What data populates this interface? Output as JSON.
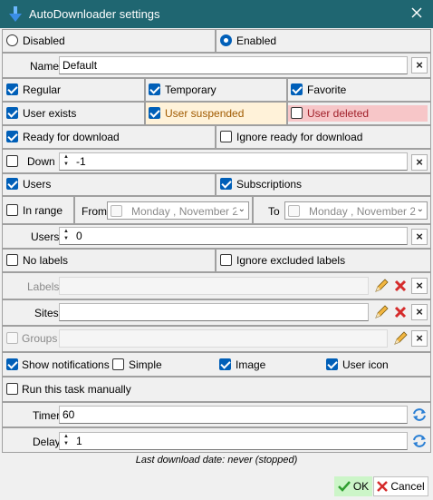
{
  "window": {
    "title": "AutoDownloader settings"
  },
  "mode": {
    "disabled": "Disabled",
    "enabled": "Enabled",
    "selected": "Enabled"
  },
  "name": {
    "label": "Name",
    "value": "Default"
  },
  "types": {
    "regular": "Regular",
    "temporary": "Temporary",
    "favorite": "Favorite",
    "user_exists": "User exists",
    "user_suspended": "User suspended",
    "user_deleted": "User deleted",
    "suspended_bg": "#fff2d9",
    "deleted_bg": "#f7c6c8"
  },
  "ready": {
    "ready_for_download": "Ready for download",
    "ignore_ready": "Ignore ready for download"
  },
  "down": {
    "label": "Down",
    "value": "-1"
  },
  "users_subs": {
    "users": "Users",
    "subscriptions": "Subscriptions"
  },
  "range": {
    "label": "In range",
    "from": "From",
    "to": "To",
    "from_date": "Monday    , November 2",
    "to_date": "Monday    , November 2"
  },
  "users_count": {
    "label": "Users",
    "value": "0"
  },
  "labels_opts": {
    "no_labels": "No labels",
    "ignore_excluded": "Ignore excluded labels"
  },
  "labels": {
    "label": "Labels",
    "value": ""
  },
  "sites": {
    "label": "Sites",
    "value": ""
  },
  "groups": {
    "label": "Groups",
    "value": ""
  },
  "notifications": {
    "show": "Show notifications",
    "simple": "Simple",
    "image": "Image",
    "user_icon": "User icon"
  },
  "manual": {
    "label": "Run this task manually"
  },
  "timer": {
    "label": "Timer",
    "value": "60"
  },
  "delay": {
    "label": "Delay",
    "value": "1"
  },
  "status": {
    "last_download": "Last download date: never (stopped)"
  },
  "footer": {
    "ok": "OK",
    "cancel": "Cancel",
    "ok_bg": "#ccf5c8"
  }
}
